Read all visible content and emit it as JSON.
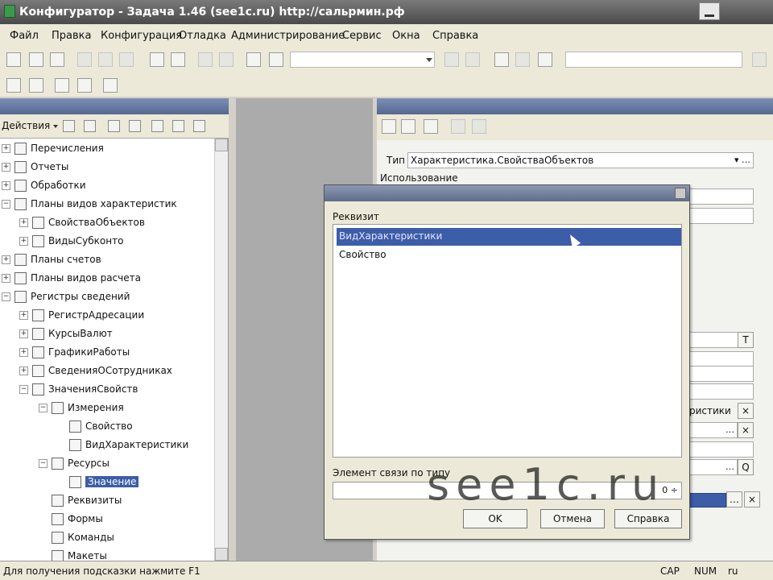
{
  "window": {
    "title": "Конфигуратор - Задача 1.46 (see1c.ru) http://сальрмин.рф"
  },
  "menu": [
    "Файл",
    "Правка",
    "Конфигурация",
    "Отладка",
    "Администрирование",
    "Сервис",
    "Окна",
    "Справка"
  ],
  "left_panel": {
    "actions_label": "Действия",
    "tree": [
      {
        "label": "Перечисления",
        "expander": "+"
      },
      {
        "label": "Отчеты",
        "expander": "+"
      },
      {
        "label": "Обработки",
        "expander": "+"
      },
      {
        "label": "Планы видов характеристик",
        "expander": "−"
      },
      {
        "label": "СвойстваОбъектов",
        "expander": "+"
      },
      {
        "label": "ВидыСубконто",
        "expander": "+"
      },
      {
        "label": "Планы счетов",
        "expander": "+"
      },
      {
        "label": "Планы видов расчета",
        "expander": "+"
      },
      {
        "label": "Регистры сведений",
        "expander": "−"
      },
      {
        "label": "РегистрАдресации",
        "expander": "+"
      },
      {
        "label": "КурсыВалют",
        "expander": "+"
      },
      {
        "label": "ГрафикиРаботы",
        "expander": "+"
      },
      {
        "label": "СведенияОСотрудниках",
        "expander": "+"
      },
      {
        "label": "ЗначенияСвойств",
        "expander": "−"
      },
      {
        "label": "Измерения",
        "expander": "−"
      },
      {
        "label": "Свойство",
        "expander": ""
      },
      {
        "label": "ВидХарактеристики",
        "expander": ""
      },
      {
        "label": "Ресурсы",
        "expander": "−"
      },
      {
        "label": "Значение",
        "expander": "",
        "selected": true
      },
      {
        "label": "Реквизиты",
        "expander": ""
      },
      {
        "label": "Формы",
        "expander": ""
      },
      {
        "label": "Команды",
        "expander": ""
      },
      {
        "label": "Макеты",
        "expander": ""
      }
    ]
  },
  "right_panel": {
    "type_label": "Тип",
    "type_value": "Характеристика.СвойстваОбъектов",
    "section_usage": "Использование",
    "partial_text": "ристики"
  },
  "dialog": {
    "list_label": "Реквизит",
    "items": [
      {
        "label": "ВидХарактеристики",
        "selected": true
      },
      {
        "label": "Свойство",
        "selected": false
      }
    ],
    "link_label": "Элемент связи по типу",
    "link_value": "",
    "buttons": {
      "ok": "OK",
      "cancel": "Отмена",
      "help": "Справка"
    }
  },
  "status": {
    "hint": "Для получения подсказки нажмите F1",
    "cap": "CAP",
    "num": "NUM",
    "lang": "ru"
  },
  "watermark": "see1c.ru"
}
